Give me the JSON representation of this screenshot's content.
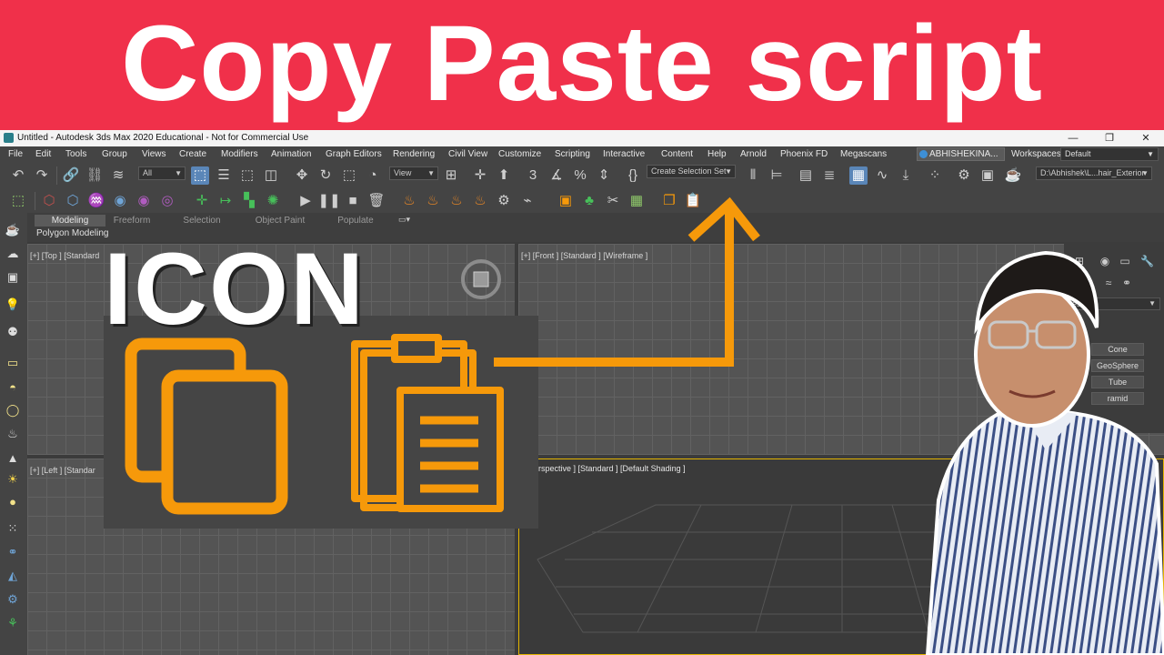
{
  "banner": {
    "title": "Copy Paste script"
  },
  "overlay": {
    "label": "ICON"
  },
  "window": {
    "title": "Untitled - Autodesk 3ds Max 2020 Educational - Not for Commercial Use",
    "controls": {
      "minimize": "—",
      "maximize": "❐",
      "close": "✕"
    }
  },
  "menu": {
    "items": [
      "File",
      "Edit",
      "Tools",
      "Group",
      "Views",
      "Create",
      "Modifiers",
      "Animation",
      "Graph Editors",
      "Rendering",
      "Civil View",
      "Customize",
      "Scripting",
      "Interactive",
      "Content",
      "Help",
      "Arnold",
      "Phoenix FD",
      "Megascans"
    ],
    "user": "ABHISHEKINA...",
    "workspaces_label": "Workspaces:",
    "workspace_value": "Default"
  },
  "toolbar": {
    "selection_filter": "All",
    "reference_coord": "View",
    "selection_set": "Create Selection Set",
    "project_path": "D:\\Abhishek\\L...hair_Exterior"
  },
  "ribbon": {
    "tabs": [
      "Modeling",
      "Freeform",
      "Selection",
      "Object Paint",
      "Populate"
    ],
    "active_tab": "Modeling",
    "subtitle": "Polygon Modeling"
  },
  "viewports": {
    "top": "[+] [Top ] [Standard",
    "front": "[+] [Front ] [Standard ] [Wireframe ]",
    "left": "[+] [Left ] [Standar",
    "perspective": "Perspective ] [Standard ] [Default Shading ]"
  },
  "command_panel": {
    "dropdown": "es",
    "buttons": [
      "Cone",
      "GeoSphere",
      "Tube",
      "ramid"
    ]
  },
  "colors": {
    "banner": "#f0304a",
    "accent_orange": "#f6990a",
    "active_tool": "#5a86b8",
    "ui_background": "#444444"
  }
}
